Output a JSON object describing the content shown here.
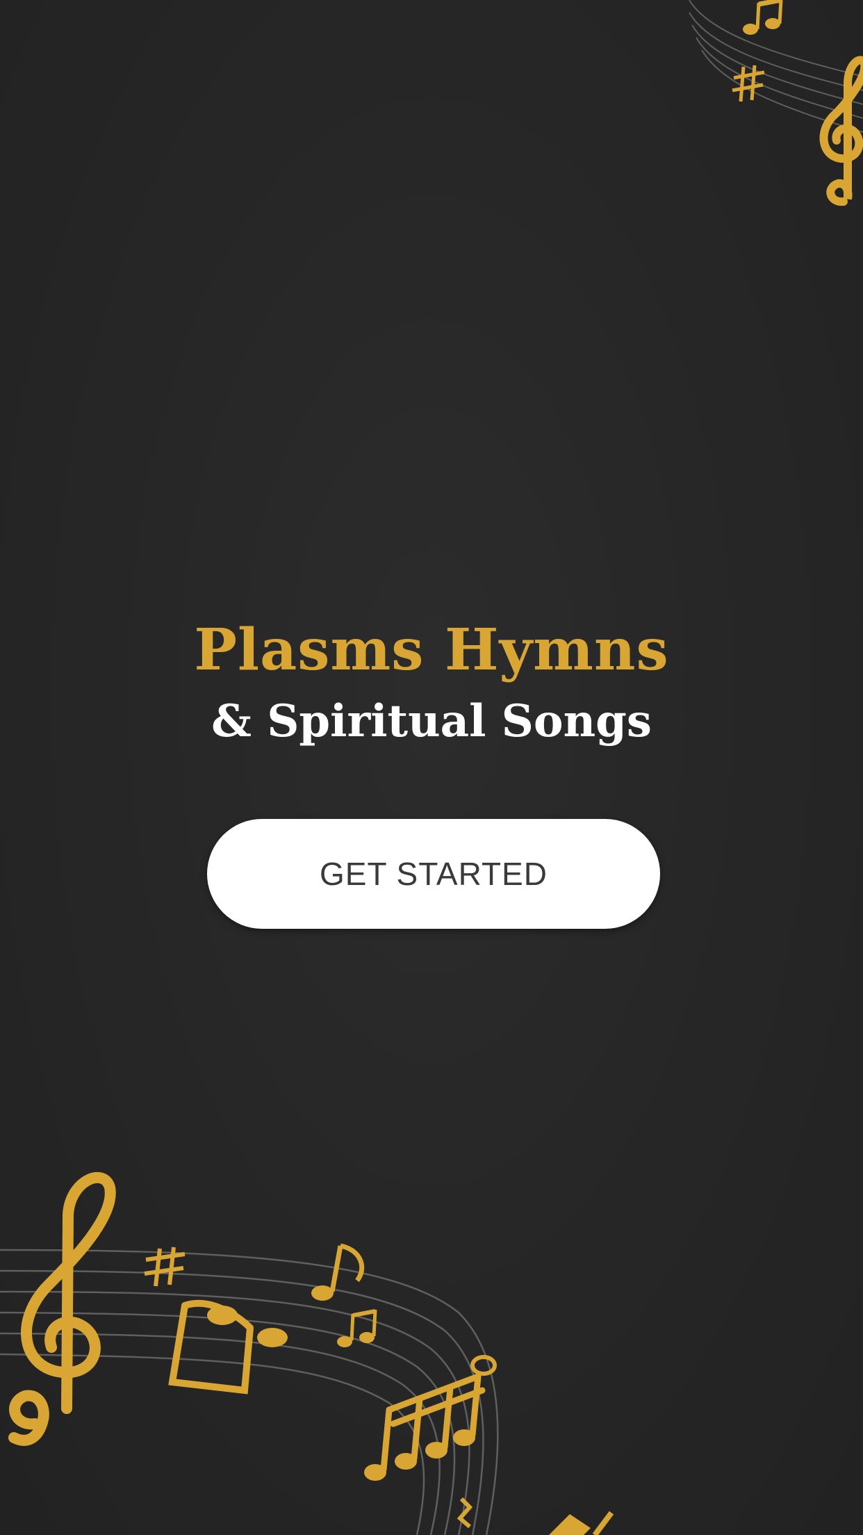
{
  "splash": {
    "title": "Plasms Hymns",
    "subtitle": "& Spiritual Songs",
    "get_started_label": "GET STARTED"
  },
  "decor": {
    "icons": [
      "treble-clef-icon",
      "music-note-icon",
      "sharp-sign-icon",
      "music-staff"
    ]
  },
  "colors": {
    "background": "#262626",
    "accent_gold": "#d9a634",
    "subtitle": "#ffffff",
    "button_bg": "#ffffff",
    "button_text": "#3a3a3a"
  }
}
